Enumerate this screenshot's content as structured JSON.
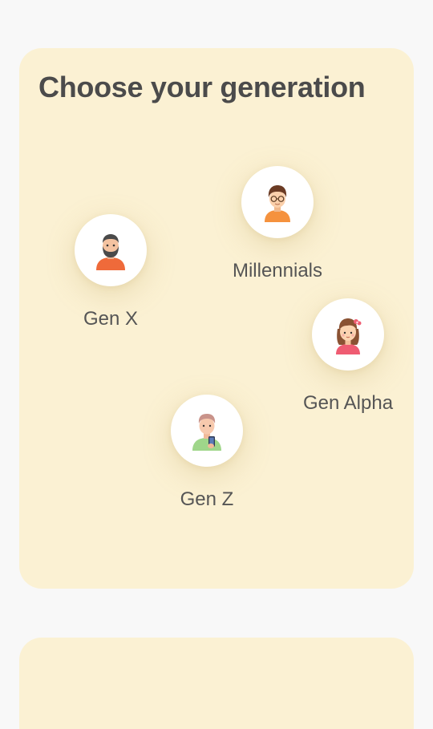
{
  "page": {
    "title": "Choose your generation"
  },
  "generations": [
    {
      "id": "gen-x",
      "label": "Gen X",
      "icon": "bearded-man-icon"
    },
    {
      "id": "millennials",
      "label": "Millennials",
      "icon": "man-with-glasses-icon"
    },
    {
      "id": "gen-alpha",
      "label": "Gen Alpha",
      "icon": "girl-with-bow-icon"
    },
    {
      "id": "gen-z",
      "label": "Gen Z",
      "icon": "boy-with-phone-icon"
    }
  ],
  "colors": {
    "background": "#f8f8f8",
    "card": "#fbf1d3",
    "title_text": "#4b4b4b",
    "label_text": "#555555",
    "avatar_bg": "#ffffff"
  }
}
